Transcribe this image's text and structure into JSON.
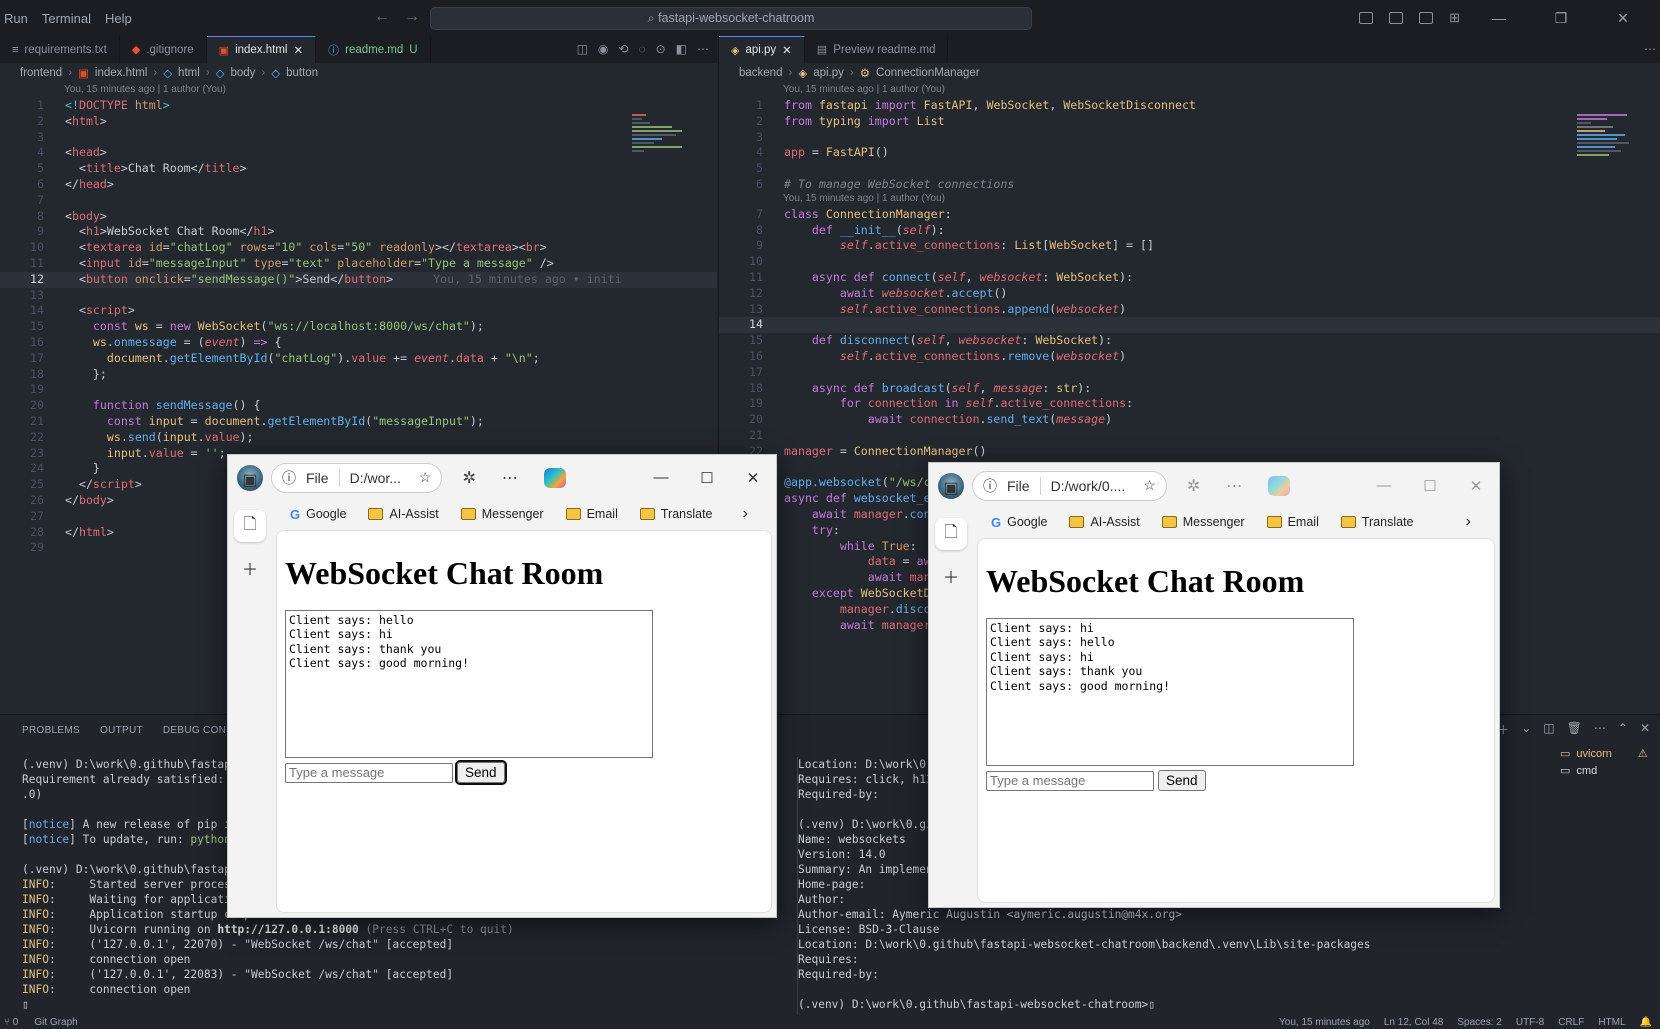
{
  "menu": [
    "Run",
    "Terminal",
    "Help"
  ],
  "command_center": "fastapi-websocket-chatroom",
  "left_editor": {
    "tabs": [
      {
        "label": "requirements.txt",
        "active": false
      },
      {
        "label": ".gitignore",
        "active": false
      },
      {
        "label": "index.html",
        "active": true
      },
      {
        "label": "readme.md",
        "badge": "U",
        "active": false
      }
    ],
    "breadcrumbs": [
      "frontend",
      "index.html",
      "html",
      "body",
      "button"
    ],
    "blame_top": "You, 15 minutes ago | 1 author (You)",
    "ghost_blame": "You, 15 minutes ago • initi",
    "current_line": "12"
  },
  "right_editor": {
    "tabs": [
      {
        "label": "api.py",
        "active": true
      },
      {
        "label": "Preview readme.md",
        "active": false
      }
    ],
    "breadcrumbs": [
      "backend",
      "api.py",
      "ConnectionManager"
    ],
    "blame_top": "You, 15 minutes ago | 1 author (You)",
    "blame_class": "You, 15 minutes ago | 1 author (You)",
    "current_line": "14"
  },
  "panel": {
    "tabs": [
      "PROBLEMS",
      "OUTPUT",
      "DEBUG CONSOLE"
    ],
    "terminals": [
      "uvicorn",
      "cmd"
    ],
    "cmd_label": "md"
  },
  "status": {
    "left": [
      "0",
      "Git Graph"
    ],
    "right": [
      "You, 15 minutes ago",
      "Ln 12, Col 48",
      "Spaces: 2",
      "UTF-8",
      "CRLF",
      "HTML"
    ]
  },
  "browser1": {
    "file_label": "File",
    "address": "D:/wor...",
    "bookmarks": [
      "Google",
      "AI-Assist",
      "Messenger",
      "Email",
      "Translate"
    ],
    "heading": "WebSocket Chat Room",
    "chat_log": "Client says: hello\nClient says: hi\nClient says: thank you\nClient says: good morning!",
    "input_placeholder": "Type a message",
    "send_label": "Send"
  },
  "browser2": {
    "file_label": "File",
    "address": "D:/work/0....",
    "bookmarks": [
      "Google",
      "AI-Assist",
      "Messenger",
      "Email",
      "Translate"
    ],
    "heading": "WebSocket Chat Room",
    "chat_log": "Client says: hi\nClient says: hello\nClient says: hi\nClient says: thank you\nClient says: good morning!",
    "input_placeholder": "Type a message",
    "send_label": "Send"
  }
}
